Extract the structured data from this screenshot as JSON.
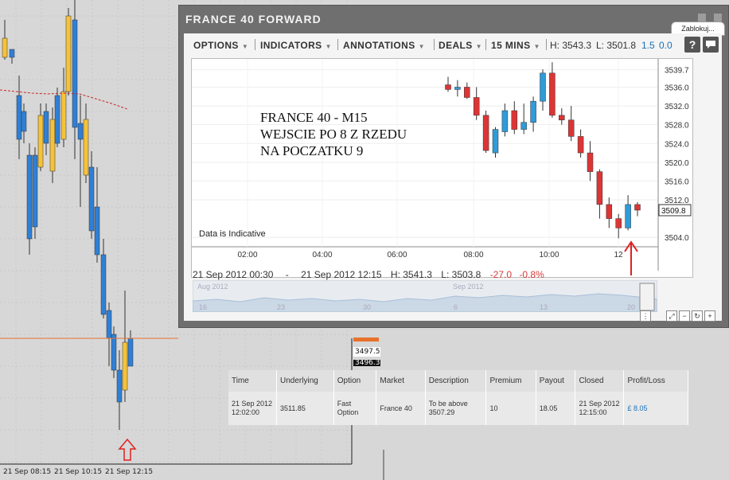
{
  "background_chart": {
    "time_labels": [
      "21 Sep 08:15",
      "21 Sep 10:15",
      "21 Sep 12:15"
    ],
    "price_labels": [
      "3497.5",
      "3496.3"
    ],
    "colors": {
      "bull": "#f5c23a",
      "bear": "#2f7fd6",
      "horizontal_line": "#e8722c",
      "ma_line": "#c62828",
      "arrow": "#e02020"
    }
  },
  "widget": {
    "title": "FRANCE 40 FORWARD",
    "lock_tab": "Zablokuj...",
    "toolbar": {
      "options": "OPTIONS",
      "indicators": "INDICATORS",
      "annotations": "ANNOTATIONS",
      "deals": "DEALS",
      "interval": "15 MINS",
      "high": "H: 3543.3",
      "low": "L: 3501.8",
      "change_pts": "1.5",
      "change_pct": "0.0",
      "help_icon": "help-icon",
      "comment_icon": "comment-icon"
    },
    "chart": {
      "annotation_lines": [
        "FRANCE 40 - M15",
        "WEJSCIE PO 8 Z RZEDU",
        "NA POCZATKU 9"
      ],
      "indicative_note": "Data is Indicative",
      "current_price": "3509.8",
      "y_ticks": [
        "3539.7",
        "3536.0",
        "3532.0",
        "3528.0",
        "3524.0",
        "3520.0",
        "3516.0",
        "3512.0",
        "3504.0"
      ],
      "x_ticks": [
        "02:00",
        "04:00",
        "06:00",
        "08:00",
        "10:00",
        "12"
      ]
    },
    "status": {
      "range_start": "21 Sep 2012 00:30",
      "dash": "-",
      "range_end": "21 Sep 2012 12:15",
      "high": "H: 3541.3",
      "low": "L: 3503.8",
      "change_pts": "-27.0",
      "change_pct": "-0.8%"
    },
    "navigator": {
      "month_labels": [
        "Aug 2012",
        "Sep 2012"
      ],
      "day_labels": [
        "16",
        "23",
        "30",
        "6",
        "13",
        "20"
      ]
    }
  },
  "trades_table": {
    "headers": [
      "Time",
      "Underlying",
      "Option",
      "Market",
      "Description",
      "Premium",
      "Payout",
      "Closed",
      "Profit/Loss"
    ],
    "rows": [
      [
        "21 Sep 2012 12:02:00",
        "3511.85",
        "Fast Option",
        "France 40",
        "To be above 3507.29",
        "10",
        "18.05",
        "21 Sep 2012 12:15:00",
        "£ 8.05"
      ]
    ]
  },
  "chart_data": {
    "type": "candlestick",
    "title": "FRANCE 40 FORWARD",
    "interval": "15 MINS",
    "x_ticks": [
      "02:00",
      "04:00",
      "06:00",
      "08:00",
      "10:00",
      "12"
    ],
    "ylim": [
      3502,
      3541
    ],
    "candles": [
      {
        "o": 3536.5,
        "h": 3538.2,
        "l": 3535.0,
        "c": 3535.5
      },
      {
        "o": 3535.5,
        "h": 3537.5,
        "l": 3534.0,
        "c": 3536.0
      },
      {
        "o": 3536.0,
        "h": 3537.0,
        "l": 3533.5,
        "c": 3533.8
      },
      {
        "o": 3533.8,
        "h": 3536.0,
        "l": 3529.0,
        "c": 3530.0
      },
      {
        "o": 3530.0,
        "h": 3531.0,
        "l": 3522.0,
        "c": 3522.5
      },
      {
        "o": 3522.0,
        "h": 3527.5,
        "l": 3521.0,
        "c": 3527.0
      },
      {
        "o": 3526.5,
        "h": 3532.5,
        "l": 3525.5,
        "c": 3531.0
      },
      {
        "o": 3531.0,
        "h": 3533.0,
        "l": 3526.0,
        "c": 3527.0
      },
      {
        "o": 3527.0,
        "h": 3532.5,
        "l": 3526.0,
        "c": 3528.5
      },
      {
        "o": 3528.5,
        "h": 3534.0,
        "l": 3526.5,
        "c": 3533.0
      },
      {
        "o": 3533.0,
        "h": 3539.8,
        "l": 3531.0,
        "c": 3539.0
      },
      {
        "o": 3539.0,
        "h": 3541.3,
        "l": 3529.5,
        "c": 3530.0
      },
      {
        "o": 3530.0,
        "h": 3531.5,
        "l": 3528.0,
        "c": 3529.0
      },
      {
        "o": 3529.0,
        "h": 3532.0,
        "l": 3524.5,
        "c": 3525.5
      },
      {
        "o": 3525.5,
        "h": 3527.0,
        "l": 3521.0,
        "c": 3522.0
      },
      {
        "o": 3522.0,
        "h": 3524.5,
        "l": 3516.0,
        "c": 3518.0
      },
      {
        "o": 3518.0,
        "h": 3518.5,
        "l": 3508.0,
        "c": 3511.0
      },
      {
        "o": 3511.0,
        "h": 3512.5,
        "l": 3506.0,
        "c": 3508.0
      },
      {
        "o": 3508.0,
        "h": 3509.0,
        "l": 3503.8,
        "c": 3506.0
      },
      {
        "o": 3506.0,
        "h": 3513.0,
        "l": 3505.5,
        "c": 3511.0
      },
      {
        "o": 3511.0,
        "h": 3511.5,
        "l": 3508.5,
        "c": 3509.8
      }
    ]
  }
}
